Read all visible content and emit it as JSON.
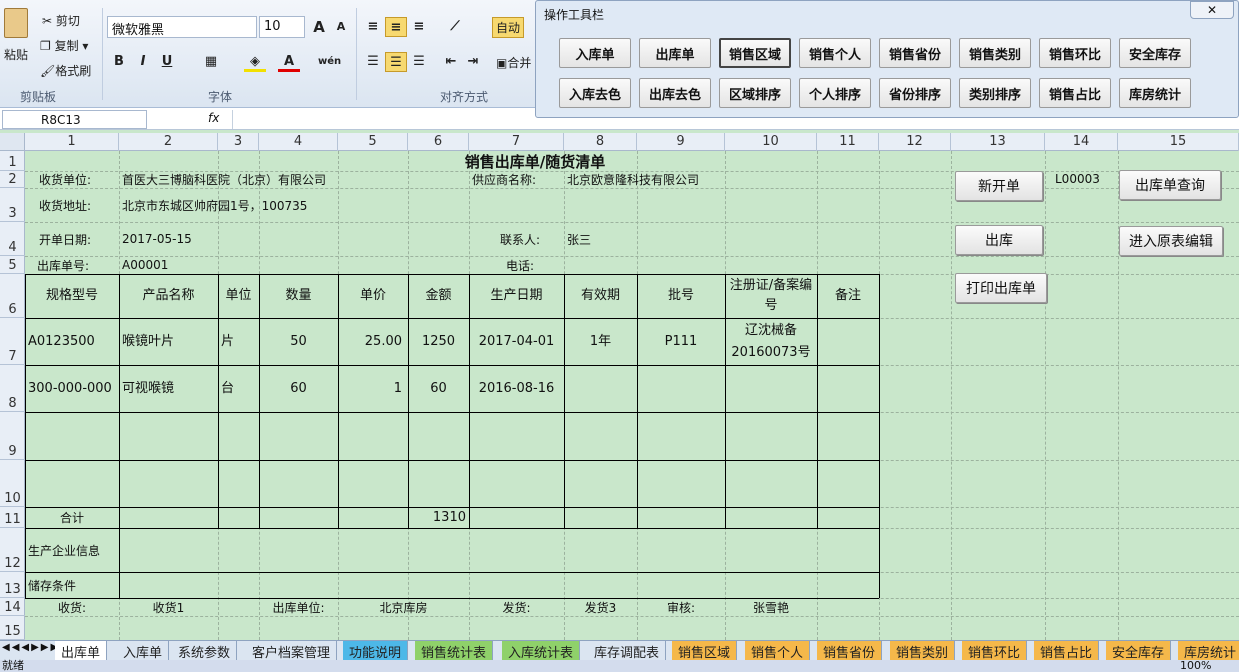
{
  "ribbon": {
    "paste": "粘贴",
    "cut": "剪切",
    "copy": "复制",
    "format_painter": "格式刷",
    "font_name": "微软雅黑",
    "font_size": "10",
    "bold": "B",
    "italic": "I",
    "underline": "U",
    "autowrap": "自动",
    "merge": "合并",
    "groups": {
      "clipboard": "剪贴板",
      "font": "字体",
      "align": "对齐方式"
    },
    "grow_font": "A",
    "shrink_font": "A",
    "wen": "wén"
  },
  "formula": {
    "name_box": "R8C13",
    "fx": "fx",
    "value": ""
  },
  "cols": [
    "1",
    "2",
    "3",
    "4",
    "5",
    "6",
    "7",
    "8",
    "9",
    "10",
    "11",
    "12",
    "13",
    "14",
    "15"
  ],
  "rows": [
    "1",
    "2",
    "3",
    "4",
    "5",
    "6",
    "7",
    "8",
    "9",
    "10",
    "11",
    "12",
    "13",
    "14",
    "15"
  ],
  "form": {
    "title": "销售出库单/随货清单",
    "receiver_label": "收货单位:",
    "receiver": "首医大三博脑科医院（北京）有限公司",
    "supplier_label": "供应商名称:",
    "supplier": "北京欧意隆科技有限公司",
    "address_label": "收货地址:",
    "address": "北京市东城区帅府园1号，100735",
    "date_label": "开单日期:",
    "date": "2017-05-15",
    "contact_label": "联系人:",
    "contact": "张三",
    "order_label": "出库单号:",
    "order": "A00001",
    "phone_label": "电话:",
    "headers": [
      "规格型号",
      "产品名称",
      "单位",
      "数量",
      "单价",
      "金额",
      "生产日期",
      "有效期",
      "批号",
      "注册证/备案编号",
      "备注"
    ],
    "rows": [
      [
        "A0123500",
        "喉镜叶片",
        "片",
        "50",
        "25.00",
        "1250",
        "2017-04-01",
        "1年",
        "P111",
        "辽沈械备\n20160073号",
        ""
      ],
      [
        "300-000-000",
        "可视喉镜",
        "台",
        "60",
        "1",
        "60",
        "2016-08-16",
        "",
        "",
        "",
        ""
      ]
    ],
    "total_label": "合计",
    "total": "1310",
    "maker_label": "生产企业信息",
    "storage_label": "储存条件",
    "receive_label": "收货:",
    "receive_val": "收货1",
    "out_unit_label": "出库单位:",
    "out_unit": "北京库房",
    "ship_label": "发货:",
    "ship": "发货3",
    "audit_label": "审核:",
    "audit": "张雪艳"
  },
  "side": {
    "new_order": "新开单",
    "code": "L00003",
    "query": "出库单查询",
    "out": "出库",
    "edit": "进入原表编辑",
    "print": "打印出库单"
  },
  "toolbar": {
    "title": "操作工具栏",
    "close": "✕",
    "row1": [
      "入库单",
      "出库单",
      "销售区域",
      "销售个人",
      "销售省份",
      "销售类别",
      "销售环比",
      "安全库存"
    ],
    "row2": [
      "入库去色",
      "出库去色",
      "区域排序",
      "个人排序",
      "省份排序",
      "类别排序",
      "销售占比",
      "库房统计"
    ],
    "active": "销售区域"
  },
  "tabs": [
    {
      "label": "出库单",
      "color": "#ffffff"
    },
    {
      "label": "入库单",
      "color": "#dbe5f1"
    },
    {
      "label": "系统参数",
      "color": "#dbe5f1"
    },
    {
      "label": "客户档案管理",
      "color": "#dbe5f1"
    },
    {
      "label": "功能说明",
      "color": "#4db8e8"
    },
    {
      "label": "销售统计表",
      "color": "#8fd16a"
    },
    {
      "label": "入库统计表",
      "color": "#8fd16a"
    },
    {
      "label": "库存调配表",
      "color": "#dbe5f1"
    },
    {
      "label": "销售区域",
      "color": "#f5b84a"
    },
    {
      "label": "销售个人",
      "color": "#f5b84a"
    },
    {
      "label": "销售省份",
      "color": "#f5b84a"
    },
    {
      "label": "销售类别",
      "color": "#f5b84a"
    },
    {
      "label": "销售环比",
      "color": "#f5b84a"
    },
    {
      "label": "销售占比",
      "color": "#f5b84a"
    },
    {
      "label": "安全库存",
      "color": "#f5b84a"
    },
    {
      "label": "库房统计",
      "color": "#f5b84a"
    }
  ],
  "status": {
    "ready": "就绪",
    "zoom": "100%"
  }
}
